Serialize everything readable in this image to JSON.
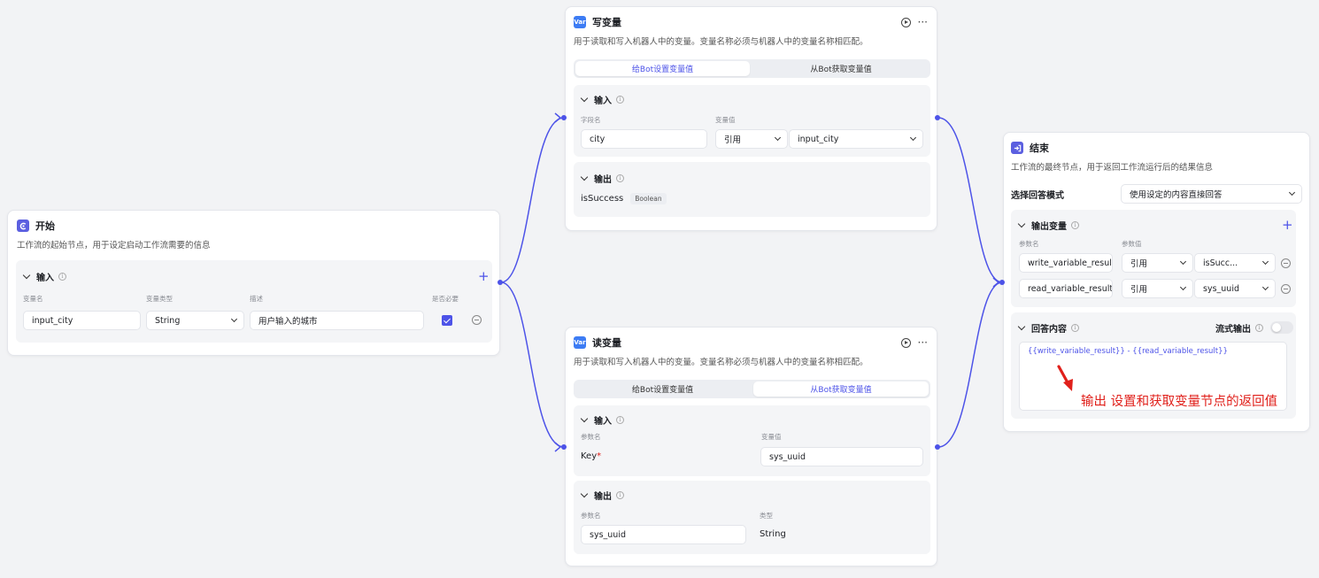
{
  "colors": {
    "accent": "#4d53e8",
    "var_icon": "#3d7cf4",
    "edge": "#4d53e8",
    "annotation": "#e0201b"
  },
  "start_node": {
    "icon": "start-icon",
    "title": "开始",
    "description": "工作流的起始节点，用于设定启动工作流需要的信息",
    "input_section": {
      "title": "输入",
      "columns": [
        "变量名",
        "变量类型",
        "描述",
        "是否必要"
      ],
      "row": {
        "name": "input_city",
        "type": "String",
        "description": "用户输入的城市",
        "required": true
      }
    }
  },
  "write_node": {
    "icon_label": "Var",
    "title": "写变量",
    "description": "用于读取和写入机器人中的变量。变量名称必须与机器人中的变量名称相匹配。",
    "tabs": [
      "给Bot设置变量值",
      "从Bot获取变量值"
    ],
    "active_tab": 0,
    "input_section": {
      "title": "输入",
      "field_label": "字段名",
      "value_label": "变量值",
      "field_value": "city",
      "value_mode": "引用",
      "value_ref": "input_city"
    },
    "output_section": {
      "title": "输出",
      "name": "isSuccess",
      "type": "Boolean"
    }
  },
  "read_node": {
    "icon_label": "Var",
    "title": "读变量",
    "description": "用于读取和写入机器人中的变量。变量名称必须与机器人中的变量名称相匹配。",
    "tabs": [
      "给Bot设置变量值",
      "从Bot获取变量值"
    ],
    "active_tab": 1,
    "input_section": {
      "title": "输入",
      "param_label": "参数名",
      "value_label": "变量值",
      "param_name": "Key",
      "required_mark": "*",
      "value": "sys_uuid"
    },
    "output_section": {
      "title": "输出",
      "param_label": "参数名",
      "type_label": "类型",
      "name": "sys_uuid",
      "type": "String"
    }
  },
  "end_node": {
    "icon": "end-icon",
    "title": "结束",
    "description": "工作流的最终节点，用于返回工作流运行后的结果信息",
    "mode_label": "选择回答模式",
    "mode_value": "使用设定的内容直接回答",
    "output_section": {
      "title": "输出变量",
      "param_label": "参数名",
      "value_label": "参数值",
      "rows": [
        {
          "name": "write_variable_result",
          "mode": "引用",
          "ref": "isSucc..."
        },
        {
          "name": "read_variable_result",
          "mode": "引用",
          "ref": "sys_uuid"
        }
      ]
    },
    "answer_section": {
      "title": "回答内容",
      "stream_label": "流式输出",
      "stream_on": false,
      "content": "{{write_variable_result}} - {{read_variable_result}}"
    }
  },
  "annotation": {
    "text": "输出 设置和获取变量节点的返回值"
  }
}
